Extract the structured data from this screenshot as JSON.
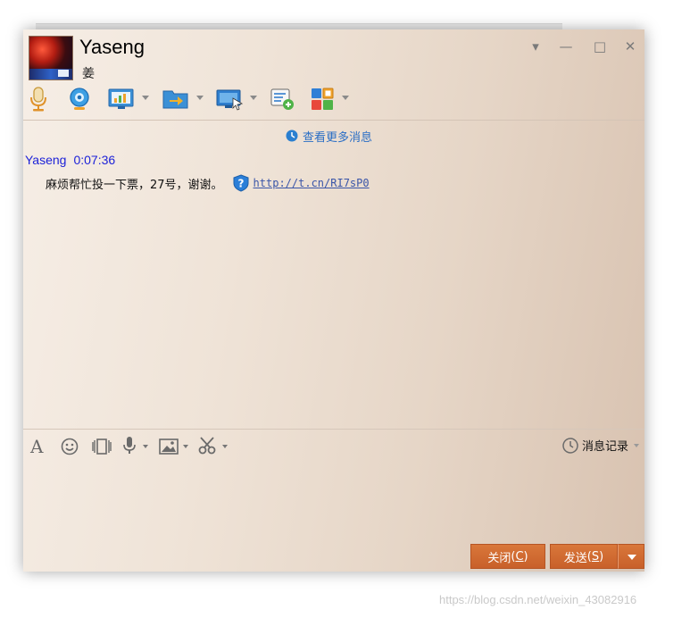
{
  "header": {
    "contact_name": "Yaseng",
    "contact_sub": "姜"
  },
  "window_controls": {
    "dropdown": "▾",
    "minimize": "—",
    "maximize": "□",
    "close": "✕"
  },
  "toolbar": {
    "icons": [
      "microphone-icon",
      "webcam-icon",
      "screen-share-icon",
      "file-transfer-icon",
      "remote-desktop-icon",
      "add-message-icon",
      "apps-grid-icon"
    ]
  },
  "chat": {
    "more_messages": "查看更多消息",
    "messages": [
      {
        "sender": "Yaseng",
        "time": "0:07:36",
        "text": "麻烦帮忙投一下票，27号，谢谢。",
        "url": "http://t.cn/RI7sP0"
      }
    ]
  },
  "input_toolbar": {
    "font_label": "A",
    "history_label": "消息记录"
  },
  "buttons": {
    "close_label": "关闭",
    "close_key": "C",
    "send_label": "发送",
    "send_key": "S"
  },
  "colors": {
    "accent_button": "#c8602a",
    "sender_name": "#1d22d8",
    "link": "#2a6ec5"
  },
  "watermark": "https://blog.csdn.net/weixin_43082916"
}
